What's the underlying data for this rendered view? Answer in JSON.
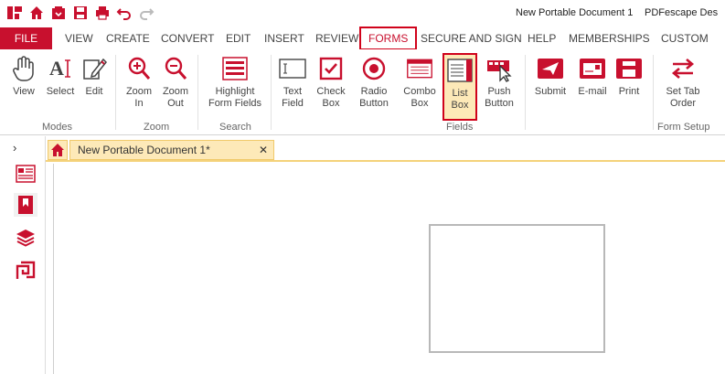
{
  "titlebar": {
    "document_title": "New Portable Document 1",
    "app_name": "PDFescape Des"
  },
  "quick_access": [
    "app-logo-icon",
    "home-icon",
    "open-icon",
    "save-icon",
    "print-icon",
    "undo-icon",
    "redo-icon"
  ],
  "menu": {
    "file": "FILE",
    "tabs": [
      "VIEW",
      "CREATE",
      "CONVERT",
      "EDIT",
      "INSERT",
      "REVIEW",
      "FORMS",
      "SECURE AND SIGN",
      "HELP",
      "MEMBERSHIPS",
      "CUSTOM"
    ],
    "active": "FORMS"
  },
  "ribbon": {
    "groups": {
      "modes": "Modes",
      "zoom": "Zoom",
      "search": "Search",
      "fields": "Fields",
      "form_setup": "Form Setup"
    },
    "buttons": {
      "view": "View",
      "select": "Select",
      "edit": "Edit",
      "zoom_in_1": "Zoom",
      "zoom_in_2": "In",
      "zoom_out_1": "Zoom",
      "zoom_out_2": "Out",
      "highlight_1": "Highlight",
      "highlight_2": "Form Fields",
      "text_field_1": "Text",
      "text_field_2": "Field",
      "check_box_1": "Check",
      "check_box_2": "Box",
      "radio_1": "Radio",
      "radio_2": "Button",
      "combo_1": "Combo",
      "combo_2": "Box",
      "list_box_1": "List",
      "list_box_2": "Box",
      "push_1": "Push",
      "push_2": "Button",
      "submit": "Submit",
      "email": "E-mail",
      "print": "Print",
      "set_tab_1": "Set Tab",
      "set_tab_2": "Order"
    }
  },
  "doc_tab": {
    "label": "New Portable Document 1*",
    "close": "✕"
  },
  "sidebar": {
    "expander": "›"
  },
  "colors": {
    "accent": "#c8102e",
    "tab_highlight": "#fde9b8"
  }
}
